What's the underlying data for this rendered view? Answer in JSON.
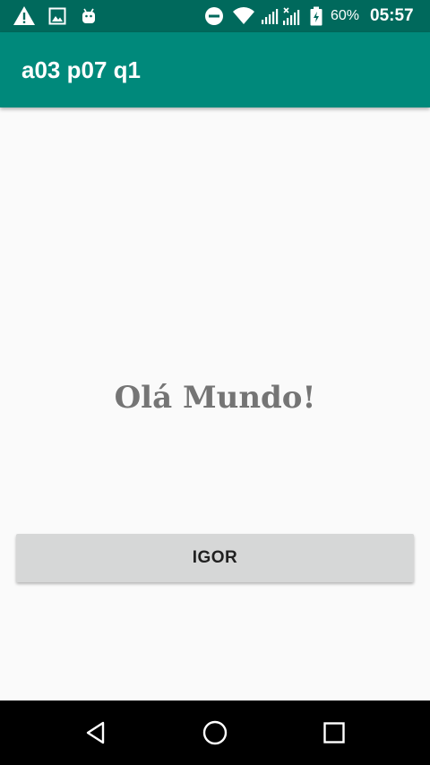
{
  "status_bar": {
    "icons": [
      "warning-icon",
      "image-icon",
      "android-icon",
      "do-not-disturb-icon",
      "wifi-icon",
      "signal-icon",
      "battery-icon"
    ],
    "battery_percent": "60%",
    "time": "05:57",
    "background_color": "#00695c"
  },
  "app_bar": {
    "title": "a03 p07 q1",
    "background_color": "#00897b"
  },
  "main": {
    "greeting": "Olá Mundo!",
    "button_label": "IGOR"
  },
  "nav_bar": {
    "buttons": [
      "back-icon",
      "home-icon",
      "recents-icon"
    ]
  }
}
